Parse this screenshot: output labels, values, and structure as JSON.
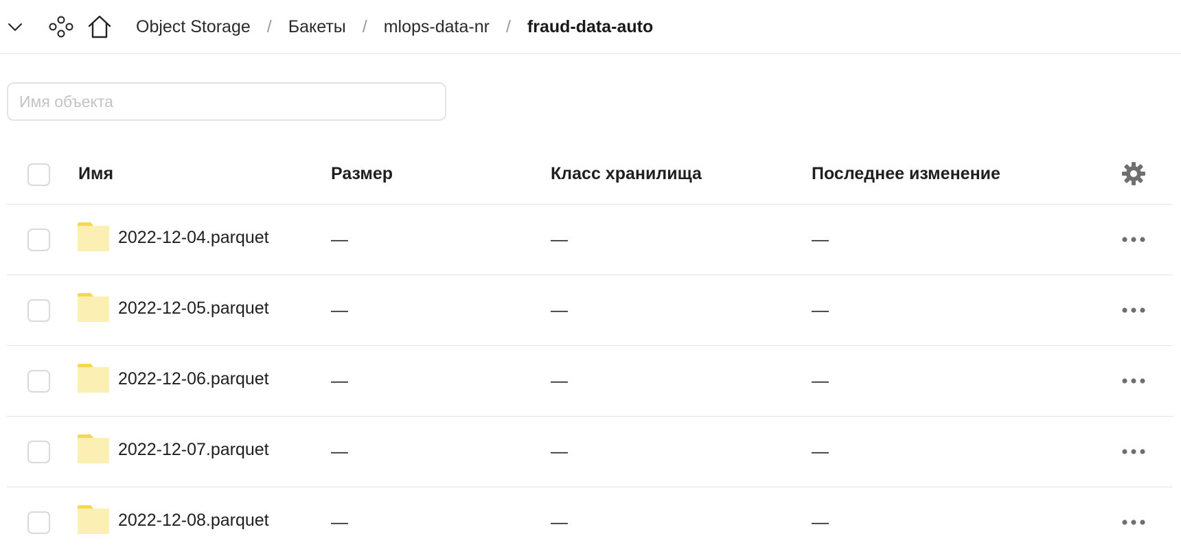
{
  "header": {
    "icons": {
      "collapse": "chevron-down-icon",
      "services": "services-icon",
      "home": "home-icon"
    },
    "breadcrumb": [
      {
        "label": "Object Storage"
      },
      {
        "label": "Бакеты"
      },
      {
        "label": "mlops-data-nr"
      }
    ],
    "breadcrumb_separator": "/",
    "current": "fraud-data-auto"
  },
  "search": {
    "placeholder": "Имя объекта",
    "value": ""
  },
  "table": {
    "columns": {
      "name": "Имя",
      "size": "Размер",
      "storage_class": "Класс хранилища",
      "modified": "Последнее изменение"
    },
    "settings_icon": "gear-icon",
    "rows": [
      {
        "name": "2022-12-04.parquet",
        "type": "folder",
        "size": "—",
        "storage_class": "—",
        "modified": "—"
      },
      {
        "name": "2022-12-05.parquet",
        "type": "folder",
        "size": "—",
        "storage_class": "—",
        "modified": "—"
      },
      {
        "name": "2022-12-06.parquet",
        "type": "folder",
        "size": "—",
        "storage_class": "—",
        "modified": "—"
      },
      {
        "name": "2022-12-07.parquet",
        "type": "folder",
        "size": "—",
        "storage_class": "—",
        "modified": "—"
      },
      {
        "name": "2022-12-08.parquet",
        "type": "folder",
        "size": "—",
        "storage_class": "—",
        "modified": "—"
      }
    ],
    "row_action_icon": "more-horizontal-icon"
  },
  "colors": {
    "folder_body": "#fcefb4",
    "folder_tab": "#f6d752",
    "border": "#e3e3e3",
    "icon_gray": "#6f6f6f",
    "text": "#1f1f1f"
  }
}
